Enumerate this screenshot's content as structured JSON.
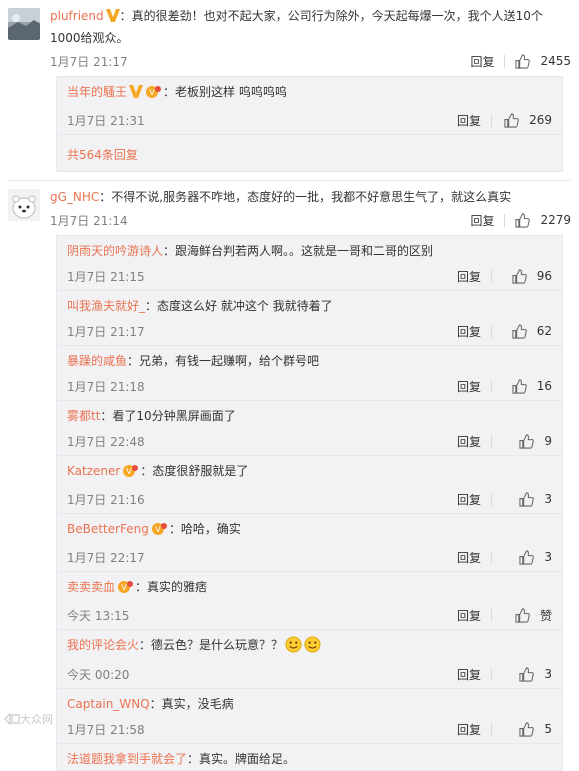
{
  "comments": [
    {
      "user": "plufriend",
      "text": "：真的很差劲！也对不起大家，公司行为除外，今天起每爆一次，我个人送10个1000给观众。",
      "time": "1月7日 21:17",
      "reply_label": "回复",
      "likes": "2455",
      "replies": [
        {
          "user": "当年的騷王",
          "text": "：老板别这样 呜呜呜呜",
          "time": "1月7日 21:31",
          "reply_label": "回复",
          "likes": "269"
        }
      ],
      "more": "共564条回复"
    },
    {
      "user": "gG_NHC",
      "text": "：不得不说,服务器不咋地，态度好的一批，我都不好意思生气了，就这么真实",
      "time": "1月7日 21:14",
      "reply_label": "回复",
      "likes": "2279",
      "replies": [
        {
          "user": "阴雨天的吟游诗人",
          "text": "：跟海鲜台判若两人啊。。这就是一哥和二哥的区别",
          "time": "1月7日 21:15",
          "reply_label": "回复",
          "likes": "96"
        },
        {
          "user": "叫我渔夫就好_",
          "text": "：态度这么好 就冲这个 我就待着了",
          "time": "1月7日 21:17",
          "reply_label": "回复",
          "likes": "62"
        },
        {
          "user": "暴躁的咸鱼",
          "text": "：兄弟，有钱一起赚啊，给个群号吧",
          "time": "1月7日 21:18",
          "reply_label": "回复",
          "likes": "16"
        },
        {
          "user": "雾都tt",
          "text": "：看了10分钟黑屏画面了",
          "time": "1月7日 22:48",
          "reply_label": "回复",
          "likes": "9"
        },
        {
          "user": "Katzener",
          "text": "：态度很舒服就是了",
          "time": "1月7日 21:16",
          "reply_label": "回复",
          "likes": "3"
        },
        {
          "user": "BeBetterFeng",
          "text": "：哈哈，确实",
          "time": "1月7日 22:17",
          "reply_label": "回复",
          "likes": "3"
        },
        {
          "user": "卖卖卖血",
          "text": "：真实的雅痞",
          "time": "今天 13:15",
          "reply_label": "回复",
          "likes": "赞"
        },
        {
          "user": "我的评论会火",
          "text": "：德云色？是什么玩意？？",
          "time": "今天 00:20",
          "reply_label": "回复",
          "likes": "3"
        },
        {
          "user": "Captain_WNQ",
          "text": "：真实，没毛病",
          "time": "1月7日 21:58",
          "reply_label": "回复",
          "likes": "5"
        },
        {
          "user": "法道题我拿到手就会了",
          "text": "：真实。牌面给足。",
          "time": "",
          "reply_label": "",
          "likes": ""
        }
      ]
    }
  ],
  "watermark": "大众网",
  "colors": {
    "link": "#eb7350",
    "meta": "#808080",
    "reply_bg": "#f2f2f5",
    "badge": "#f5a623"
  }
}
